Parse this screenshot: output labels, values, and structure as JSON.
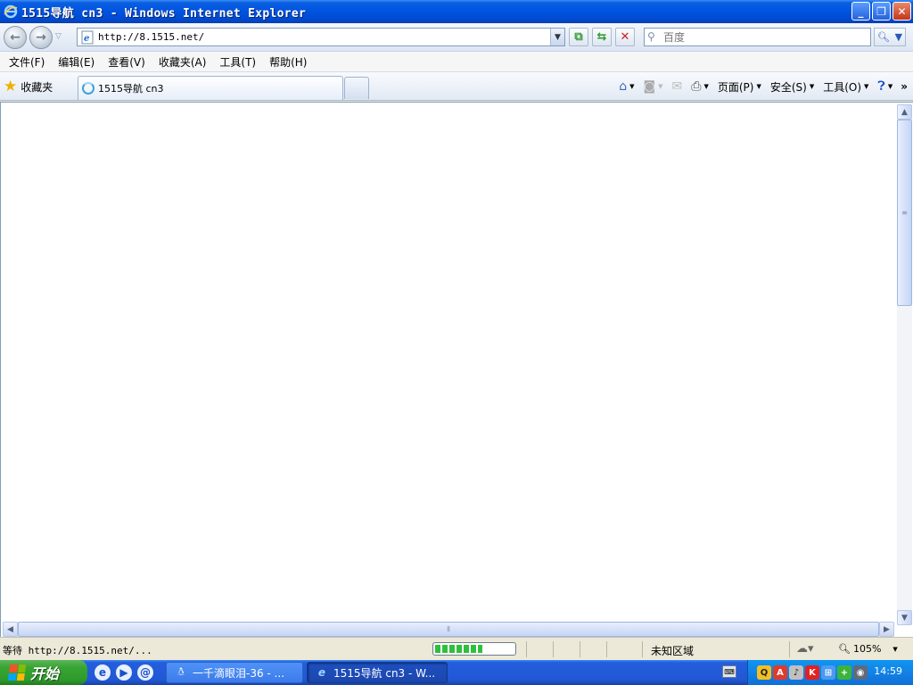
{
  "window": {
    "title": "1515导航 cn3 - Windows Internet Explorer",
    "minimize_label": "_",
    "restore_label": "❐",
    "close_label": "✕"
  },
  "navigation": {
    "back_icon": "back-arrow-icon",
    "forward_icon": "forward-arrow-icon",
    "address_url": "http://8.1515.net/",
    "search_placeholder": "百度"
  },
  "menu": {
    "items": [
      "文件(F)",
      "编辑(E)",
      "查看(V)",
      "收藏夹(A)",
      "工具(T)",
      "帮助(H)"
    ]
  },
  "favorites_bar": {
    "favorites_label": "收藏夹",
    "tab_title": "1515导航 cn3",
    "commands": {
      "page_label": "页面(P)",
      "safety_label": "安全(S)",
      "tools_label": "工具(O)"
    }
  },
  "status_bar": {
    "status_text": "等待 http://8.1515.net/...",
    "progress": 0.6,
    "zone": "未知区域",
    "zoom": "105%"
  },
  "taskbar": {
    "start_label": "开始",
    "tasks": [
      {
        "label": "一千滴眼泪-36 - ..."
      },
      {
        "label": "1515导航 cn3 - W..."
      }
    ],
    "clock": "14:59"
  }
}
